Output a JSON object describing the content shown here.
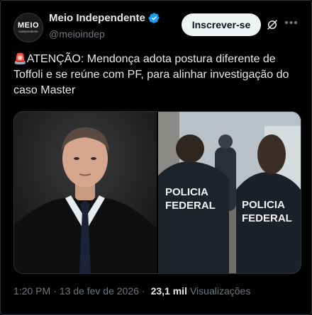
{
  "account": {
    "name": "Meio Independente",
    "handle": "@meioindep",
    "avatar_text": "MEIO",
    "avatar_subtext": "Independente",
    "verified": true,
    "verified_color": "#1d9bf0"
  },
  "actions": {
    "follow_label": "Inscrever-se",
    "grok_icon": "grok-icon",
    "more_icon": "more-icon"
  },
  "tweet": {
    "emoji": "🚨",
    "text": "ATENÇÃO: Mendonça adota postura diferente de Toffoli e se reúne com PF, para alinhar investigação do caso Master"
  },
  "media": {
    "left_image": "portrait-of-man-in-judicial-robe",
    "right_image": "policia-federal-agents",
    "vest_text": "POLICIA\nFEDERAL"
  },
  "meta": {
    "time": "1:20 PM",
    "date": "13 de fev de 2026",
    "separator": "·",
    "views_count": "23,1 mil",
    "views_label": "Visualizações"
  },
  "colors": {
    "background": "#000000",
    "text": "#e7e9ea",
    "secondary": "#71767b",
    "follow_bg": "#eff3f4"
  }
}
